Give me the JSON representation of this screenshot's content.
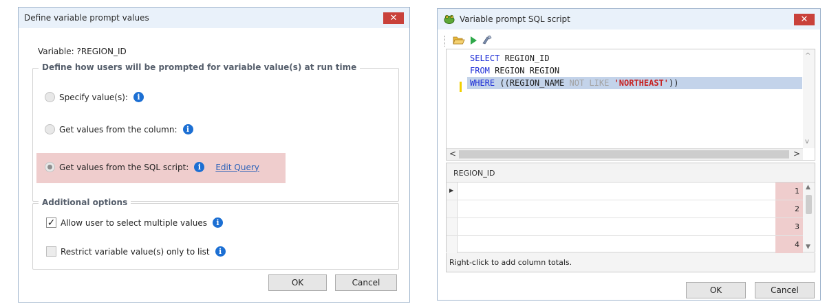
{
  "dialog1": {
    "title": "Define variable prompt values",
    "close_glyph": "✕",
    "variable_label": "Variable:",
    "variable_name": "?REGION_ID",
    "group1_legend": "Define how users will be prompted for variable value(s) at run time",
    "options": [
      {
        "label": "Specify value(s):",
        "selected": false
      },
      {
        "label": "Get values from the column:",
        "selected": false
      },
      {
        "label": "Get values from the SQL script:",
        "selected": true,
        "link": "Edit Query"
      }
    ],
    "group2_legend": "Additional options",
    "checks": [
      {
        "label": "Allow user to select multiple values",
        "checked": true
      },
      {
        "label": "Restrict variable value(s) only to list",
        "checked": false
      }
    ],
    "ok_label": "OK",
    "cancel_label": "Cancel",
    "info_glyph": "i",
    "highlight_color": "#efcdcd"
  },
  "dialog2": {
    "title": "Variable prompt SQL script",
    "close_glyph": "✕",
    "toolbar": [
      "open-folder-icon",
      "run-icon",
      "format-icon"
    ],
    "sql": {
      "line1_kw": "SELECT",
      "line1_rest": " REGION_ID",
      "line2_kw": "FROM",
      "line2_rest": " REGION REGION",
      "line3_kw": "WHERE",
      "line3_a": " ((REGION_NAME ",
      "line3_not_like": "NOT LIKE",
      "line3_sp": " ",
      "line3_str": "'NORTHEAST'",
      "line3_end": "))"
    },
    "grid": {
      "column": "REGION_ID",
      "rows": [
        "1",
        "2",
        "3",
        "4"
      ]
    },
    "status_text": "Right-click to add column totals.",
    "ok_label": "OK",
    "cancel_label": "Cancel",
    "keyword_color": "#1b2bd6",
    "string_color": "#c72020"
  }
}
